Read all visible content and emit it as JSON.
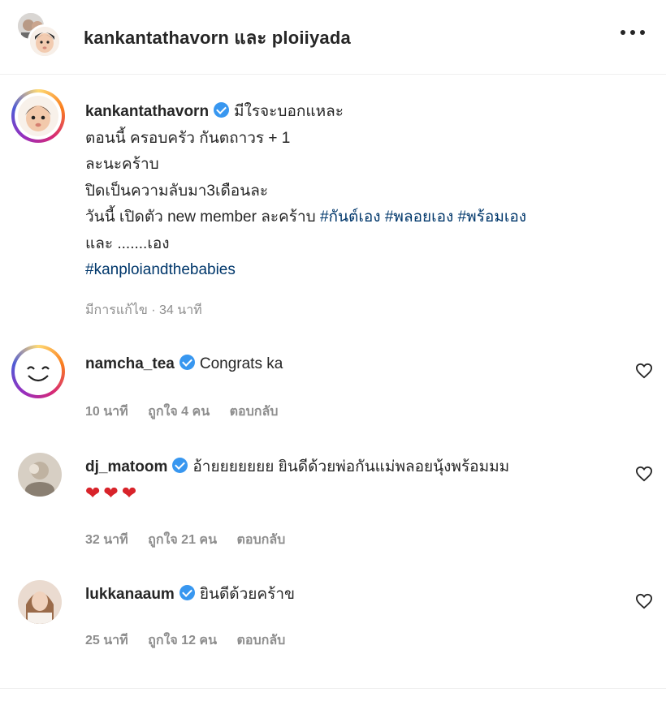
{
  "header": {
    "title": "kankantathavorn และ ploiiyada"
  },
  "caption": {
    "username": "kankantathavorn",
    "lines": [
      "มีใรจะบอกแหละ",
      "ตอนนี้ ครอบครัว กันตถาวร + 1",
      "ละนะคร้าบ",
      "ปิดเป็นความลับมา3เดือนละ",
      "วันนี้ เปิดตัว new member ละคร้าบ"
    ],
    "hashtags_line": [
      "#กันต์เอง",
      "#พลอยเอง",
      "#พร้อมเอง"
    ],
    "line_after": "และ .......เอง",
    "hashtag_final": "#kanploiandthebabies",
    "meta": "มีการแก้ไข · 34 นาที"
  },
  "comments": [
    {
      "username": "namcha_tea",
      "text": "Congrats ka",
      "time": "10 นาที",
      "likes": "ถูกใจ 4 คน",
      "reply": "ตอบกลับ"
    },
    {
      "username": "dj_matoom",
      "text": "อ้ายยยยยยย ยินดีด้วยพ่อกันแม่พลอยนุ้งพร้อมมม",
      "hearts": "❤❤❤",
      "time": "32 นาที",
      "likes": "ถูกใจ 21 คน",
      "reply": "ตอบกลับ"
    },
    {
      "username": "lukkanaaum",
      "text": "ยินดีด้วยคร้าข",
      "time": "25 นาที",
      "likes": "ถูกใจ 12 คน",
      "reply": "ตอบกลับ"
    }
  ],
  "colors": {
    "verified": "#3897f0",
    "hashtag": "#00376b",
    "muted": "#8e8e8e"
  }
}
